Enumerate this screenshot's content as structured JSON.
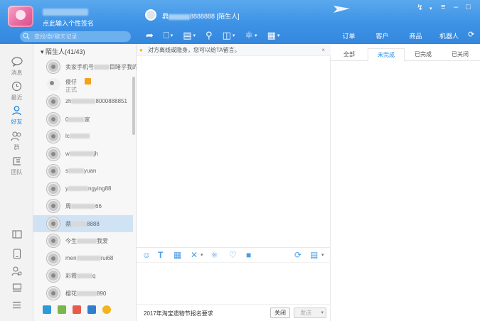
{
  "header": {
    "user_signature": "点此输入个性签名",
    "search_placeholder": "查找/群/聊天记录",
    "chat_title_prefix": "鼎",
    "chat_title_id": "8888888",
    "chat_title_suffix": "[陌生人]"
  },
  "right_header_tabs": [
    "订单",
    "客户",
    "商品",
    "机器人"
  ],
  "rail": {
    "items": [
      {
        "icon": "message-icon",
        "label": "消息"
      },
      {
        "icon": "recent-icon",
        "label": "最近"
      },
      {
        "icon": "friend-icon",
        "label": "好友"
      },
      {
        "icon": "group-icon",
        "label": "群"
      },
      {
        "icon": "team-icon",
        "label": "团队"
      }
    ]
  },
  "contacts": {
    "group_label": "陌生人(41/43)",
    "rows": [
      {
        "name": "卖家手机号",
        "sub": "",
        "tail": "目睹乎我的心"
      },
      {
        "name": "傻仔",
        "sub": "正式",
        "tail": ""
      },
      {
        "name": "zh",
        "sub": "",
        "tail": "8000888851"
      },
      {
        "name": "0",
        "sub": "",
        "tail": "家"
      },
      {
        "name": "lc",
        "sub": "",
        "tail": ""
      },
      {
        "name": "w",
        "sub": "",
        "tail": "jh"
      },
      {
        "name": "s",
        "sub": "",
        "tail": "yuan"
      },
      {
        "name": "y",
        "sub": "",
        "tail": "ngying88"
      },
      {
        "name": "周",
        "sub": "",
        "tail": "66"
      },
      {
        "name": "鼎",
        "sub": "",
        "tail": "8888"
      },
      {
        "name": "今生",
        "sub": "",
        "tail": "我爱"
      },
      {
        "name": "men",
        "sub": "",
        "tail": "rui68"
      },
      {
        "name": "彩霞",
        "sub": "",
        "tail": "q"
      },
      {
        "name": "樱花",
        "sub": "",
        "tail": "890"
      }
    ]
  },
  "chat": {
    "notice": "对方离线或隐身，您可以给TA留言。",
    "bottom_text": "2017年淘宝遗物节报名要求",
    "close_label": "关闭",
    "send_label": "发送"
  },
  "order_tabs": [
    "全部",
    "未完成",
    "已完成",
    "已关闭"
  ],
  "colors": {
    "accent": "#1e88e5",
    "header": "#3d92e6"
  }
}
